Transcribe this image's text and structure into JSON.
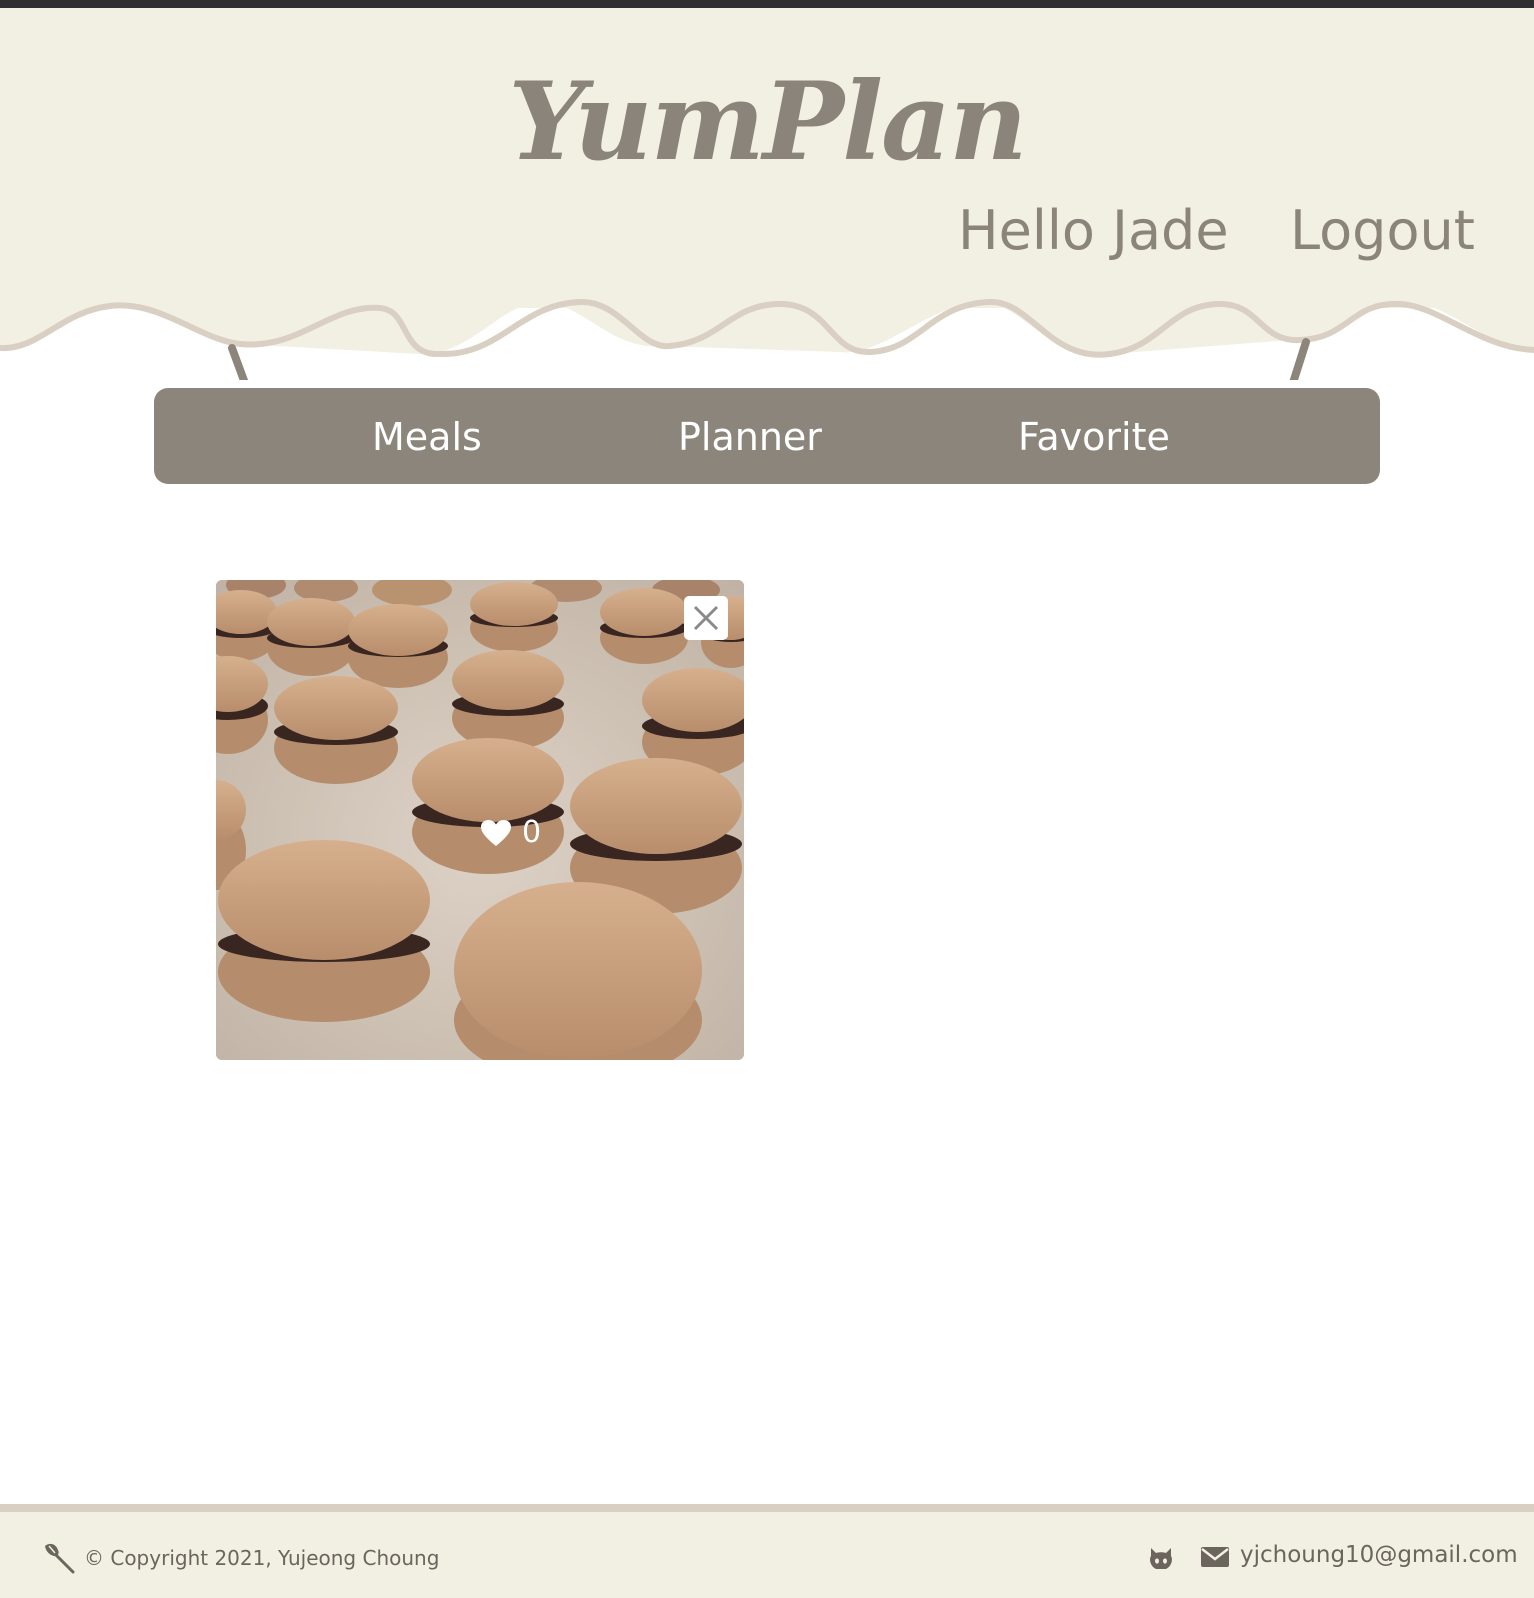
{
  "header": {
    "logo": "YumPlan",
    "greeting": "Hello Jade",
    "logout_label": "Logout"
  },
  "nav": {
    "items": [
      {
        "label": "Meals"
      },
      {
        "label": "Planner"
      },
      {
        "label": "Favorite"
      }
    ]
  },
  "favorites": [
    {
      "image": "macarons-photo",
      "likes": "0",
      "close_icon": "close-icon",
      "like_icon": "heart-icon"
    }
  ],
  "footer": {
    "copyright": "© Copyright 2021, Yujeong Choung",
    "left_icon": "whisk-icon",
    "github_icon": "github-icon",
    "mail_icon": "mail-icon",
    "email": "yjchoung10@gmail.com"
  },
  "colors": {
    "header_bg": "#f2efe3",
    "accent": "#8c857b",
    "wave_stroke": "#d9cfc2",
    "footer_text": "#6b655d"
  }
}
